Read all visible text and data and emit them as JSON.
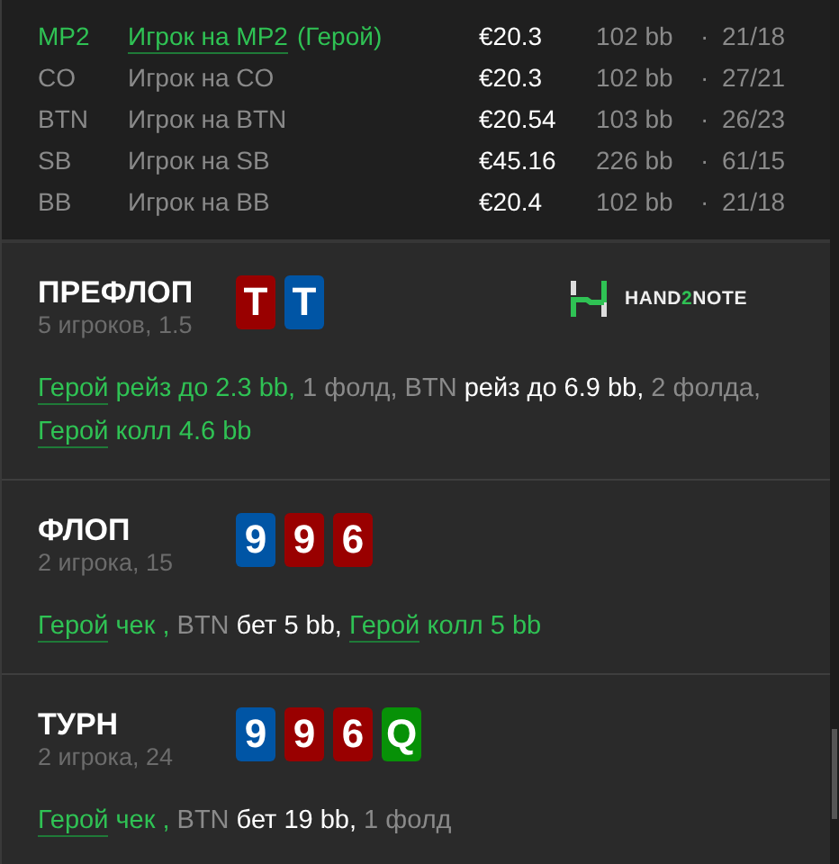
{
  "players": [
    {
      "position": "MP2",
      "name": "Игрок на MP2",
      "hero_tag": "(Герой)",
      "hero": true,
      "stack": "€20.3",
      "bb": "102 bb",
      "sep": "·",
      "stat": "21/18"
    },
    {
      "position": "CO",
      "name": "Игрок на CO",
      "hero": false,
      "stack": "€20.3",
      "bb": "102 bb",
      "sep": "·",
      "stat": "27/21"
    },
    {
      "position": "BTN",
      "name": "Игрок на BTN",
      "hero": false,
      "stack": "€20.54",
      "bb": "103 bb",
      "sep": "·",
      "stat": "26/23"
    },
    {
      "position": "SB",
      "name": "Игрок на SB",
      "hero": false,
      "stack": "€45.16",
      "bb": "226 bb",
      "sep": "·",
      "stat": "61/15"
    },
    {
      "position": "BB",
      "name": "Игрок на BB",
      "hero": false,
      "stack": "€20.4",
      "bb": "102 bb",
      "sep": "·",
      "stat": "21/18"
    }
  ],
  "logo": {
    "before": "HAND",
    "accent": "2",
    "after": "NOTE"
  },
  "streets": [
    {
      "title": "ПРЕФЛОП",
      "subtitle": "5 игроков, 1.5",
      "cards": [
        {
          "rank": "T",
          "color": "#990000"
        },
        {
          "rank": "T",
          "color": "#0055a5"
        }
      ],
      "actions": [
        {
          "kind": "hero",
          "text": "Герой"
        },
        {
          "kind": "hero_action",
          "text": " рейз до 2.3 bb,"
        },
        {
          "kind": "fold",
          "text": " 1 фолд,"
        },
        {
          "kind": "player",
          "text": " BTN"
        },
        {
          "kind": "action",
          "text": " рейз до 6.9 bb,"
        },
        {
          "kind": "fold",
          "text": " 2 фолда, "
        },
        {
          "kind": "hero",
          "text": "Герой"
        },
        {
          "kind": "hero_action",
          "text": " колл 4.6 bb"
        }
      ]
    },
    {
      "title": "ФЛОП",
      "subtitle": "2 игрока, 15",
      "cards": [
        {
          "rank": "9",
          "color": "#0055a5"
        },
        {
          "rank": "9",
          "color": "#990000"
        },
        {
          "rank": "6",
          "color": "#990000"
        }
      ],
      "actions": [
        {
          "kind": "hero",
          "text": "Герой"
        },
        {
          "kind": "hero_action",
          "text": " чек ,"
        },
        {
          "kind": "player",
          "text": " BTN"
        },
        {
          "kind": "action",
          "text": " бет 5 bb, "
        },
        {
          "kind": "hero",
          "text": "Герой"
        },
        {
          "kind": "hero_action",
          "text": " колл 5 bb"
        }
      ]
    },
    {
      "title": "ТУРН",
      "subtitle": "2 игрока, 24",
      "cards": [
        {
          "rank": "9",
          "color": "#0055a5"
        },
        {
          "rank": "9",
          "color": "#990000"
        },
        {
          "rank": "6",
          "color": "#990000"
        },
        {
          "rank": "Q",
          "color": "#079107"
        }
      ],
      "actions": [
        {
          "kind": "hero",
          "text": "Герой"
        },
        {
          "kind": "hero_action",
          "text": " чек ,"
        },
        {
          "kind": "player",
          "text": " BTN"
        },
        {
          "kind": "action",
          "text": " бет 19 bb,"
        },
        {
          "kind": "fold",
          "text": " 1 фолд"
        }
      ]
    }
  ]
}
